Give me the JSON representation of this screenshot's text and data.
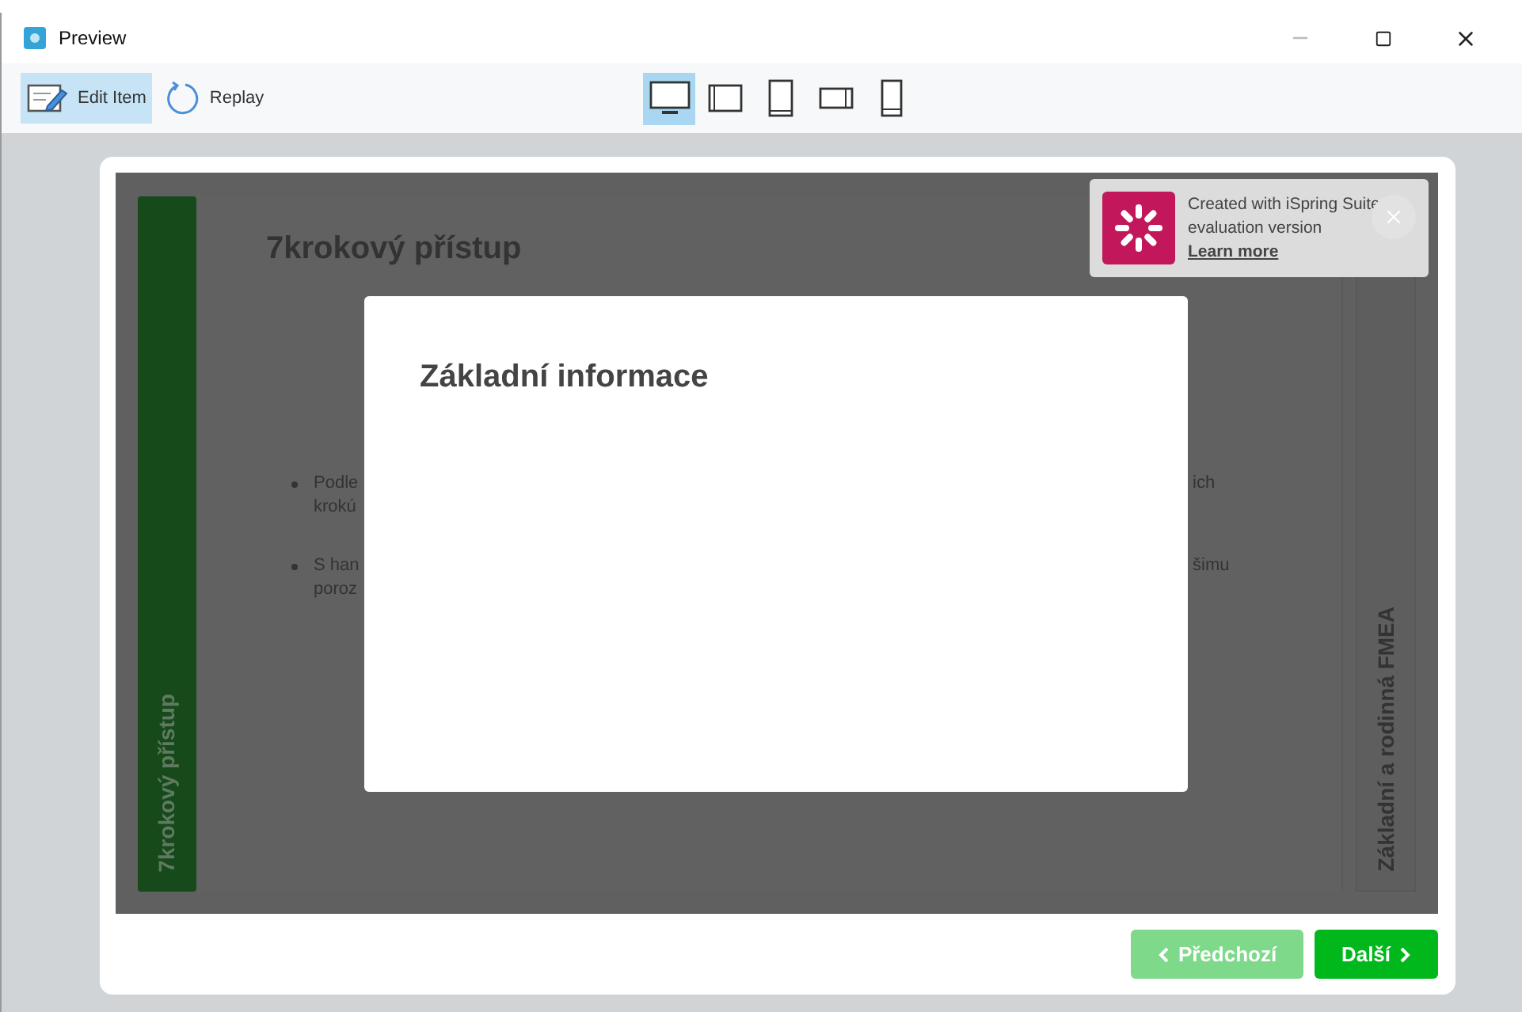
{
  "window": {
    "title": "Preview"
  },
  "toolbar": {
    "actions": [
      {
        "label": "Edit Item",
        "kind": "edit",
        "selected": true
      },
      {
        "label": "Replay",
        "kind": "replay",
        "selected": false
      }
    ],
    "devices": [
      {
        "kind": "desktop",
        "selected": true
      },
      {
        "kind": "tablet-landscape",
        "selected": false
      },
      {
        "kind": "tablet-portrait",
        "selected": false
      },
      {
        "kind": "phone-landscape",
        "selected": false
      },
      {
        "kind": "phone-portrait",
        "selected": false
      }
    ]
  },
  "slide": {
    "left_tab": "7krokový přístup",
    "title": "7krokový přístup",
    "bullets": [
      {
        "left": [
          "Podle",
          "krokú"
        ],
        "right": "ich"
      },
      {
        "left": [
          "S han",
          "poroz"
        ],
        "right": "šimu"
      }
    ],
    "right_tab": "Základní a rodinná FMEA"
  },
  "dialog": {
    "title": "Základní informace"
  },
  "evaluation_notice": {
    "lines": [
      "Created with iSpring Suite",
      "evaluation version"
    ],
    "link": "Learn more"
  },
  "navigation": [
    {
      "label": "Předchozí",
      "kind": "prev",
      "disabled": true
    },
    {
      "label": "Další",
      "kind": "next",
      "disabled": false
    }
  ]
}
